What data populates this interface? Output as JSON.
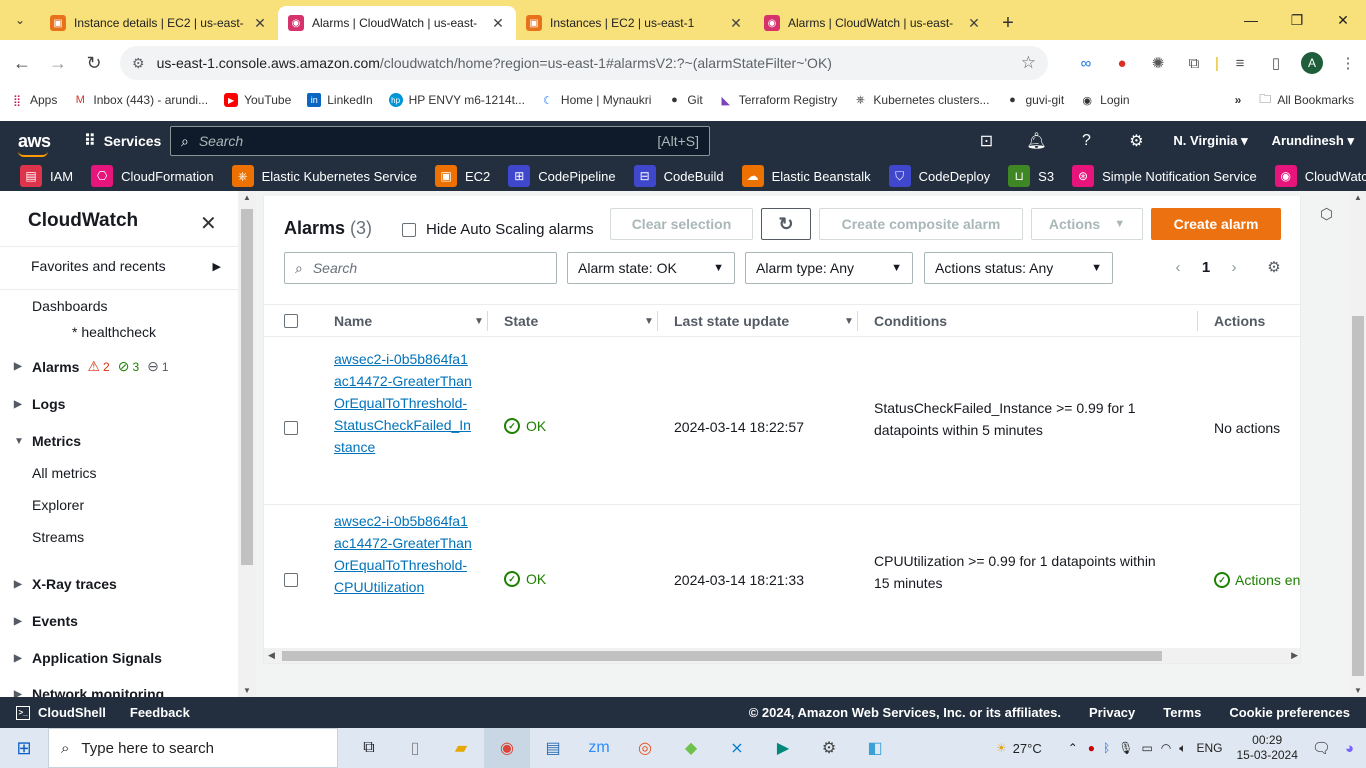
{
  "browser": {
    "tabs": [
      {
        "title": "Instance details | EC2 | us-east-",
        "color": "#e8711c",
        "active": false
      },
      {
        "title": "Alarms | CloudWatch | us-east-",
        "color": "#d6336c",
        "active": true
      },
      {
        "title": "Instances | EC2 | us-east-1",
        "color": "#e8711c",
        "active": false
      },
      {
        "title": "Alarms | CloudWatch | us-east-",
        "color": "#d6336c",
        "active": false
      }
    ],
    "url_host": "us-east-1.console.aws.amazon.com",
    "url_path": "/cloudwatch/home?region=us-east-1#alarmsV2:?~(alarmStateFilter~'OK)",
    "avatar_letter": "A",
    "bookmarks": [
      "Apps",
      "Inbox (443) - arundi...",
      "YouTube",
      "LinkedIn",
      "HP ENVY m6-1214t...",
      "Home | Mynaukri",
      "Git",
      "Terraform Registry",
      "Kubernetes clusters...",
      "guvi-git",
      "Login"
    ],
    "all_bookmarks": "All Bookmarks"
  },
  "aws_nav": {
    "logo": "aws",
    "services": "Services",
    "search_placeholder": "Search",
    "search_shortcut": "[Alt+S]",
    "region": "N. Virginia",
    "user": "Arundinesh",
    "favorites": [
      {
        "label": "IAM",
        "color": "#dd344c"
      },
      {
        "label": "CloudFormation",
        "color": "#e7157b"
      },
      {
        "label": "Elastic Kubernetes Service",
        "color": "#ed7100"
      },
      {
        "label": "EC2",
        "color": "#ed7100"
      },
      {
        "label": "CodePipeline",
        "color": "#3f48cc"
      },
      {
        "label": "CodeBuild",
        "color": "#3f48cc"
      },
      {
        "label": "Elastic Beanstalk",
        "color": "#ed7100"
      },
      {
        "label": "CodeDeploy",
        "color": "#3f48cc"
      },
      {
        "label": "S3",
        "color": "#3f8624"
      },
      {
        "label": "Simple Notification Service",
        "color": "#e7157b"
      },
      {
        "label": "CloudWatch",
        "color": "#e7157b"
      }
    ]
  },
  "sidebar": {
    "title": "CloudWatch",
    "favorites": "Favorites and recents",
    "dashboards": "Dashboards",
    "dashboard_item": "* healthcheck",
    "alarms": "Alarms",
    "alarm_counts": {
      "alarm": "2",
      "ok": "3",
      "insufficient": "1"
    },
    "logs": "Logs",
    "metrics": "Metrics",
    "metrics_items": [
      "All metrics",
      "Explorer",
      "Streams"
    ],
    "xray": "X-Ray traces",
    "events": "Events",
    "app_signals": "Application Signals",
    "network": "Network monitoring"
  },
  "alarms_panel": {
    "title": "Alarms",
    "count": "(3)",
    "hide_autoscaling": "Hide Auto Scaling alarms",
    "clear_selection": "Clear selection",
    "create_composite": "Create composite alarm",
    "actions": "Actions",
    "create_alarm": "Create alarm",
    "search_placeholder": "Search",
    "filter_state": "Alarm state: OK",
    "filter_type": "Alarm type: Any",
    "filter_actions": "Actions status: Any",
    "page": "1",
    "columns": {
      "name": "Name",
      "state": "State",
      "last_update": "Last state update",
      "conditions": "Conditions",
      "actions": "Actions"
    },
    "rows": [
      {
        "name": "awsec2-i-0b5b864fa1ac14472-GreaterThanOrEqualToThreshold-StatusCheckFailed_Instance",
        "state": "OK",
        "last_update": "2024-03-14 18:22:57",
        "conditions": "StatusCheckFailed_Instance >= 0.99 for 1 datapoints within 5 minutes",
        "actions": "No actions"
      },
      {
        "name": "awsec2-i-0b5b864fa1ac14472-GreaterThanOrEqualToThreshold-CPUUtilization",
        "state": "OK",
        "last_update": "2024-03-14 18:21:33",
        "conditions": "CPUUtilization >= 0.99 for 1 datapoints within 15 minutes",
        "actions": "Actions ena"
      }
    ]
  },
  "footer": {
    "cloudshell": "CloudShell",
    "feedback": "Feedback",
    "copyright": "© 2024, Amazon Web Services, Inc. or its affiliates.",
    "privacy": "Privacy",
    "terms": "Terms",
    "cookies": "Cookie preferences"
  },
  "taskbar": {
    "search_placeholder": "Type here to search",
    "temperature": "27°C",
    "lang": "ENG",
    "time": "00:29",
    "date": "15-03-2024"
  }
}
